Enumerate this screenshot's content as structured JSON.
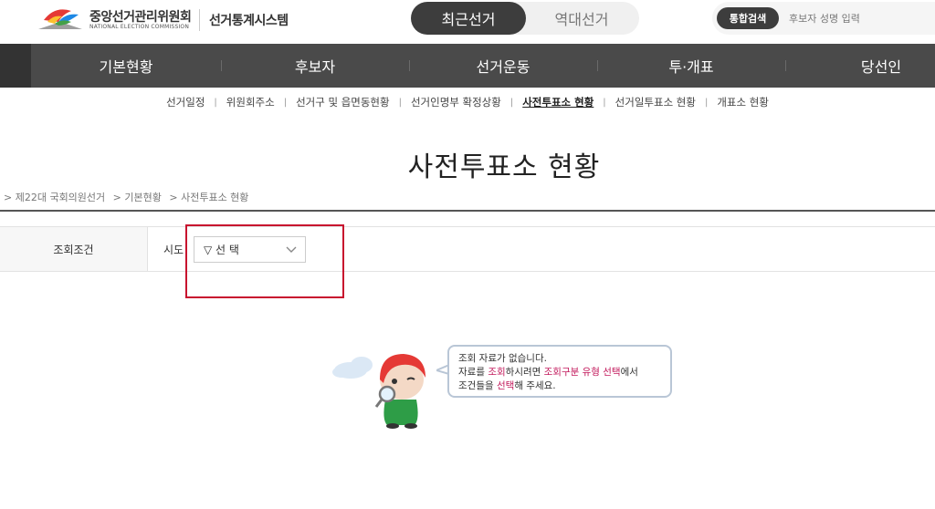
{
  "header": {
    "org_name": "중앙선거관리위원회",
    "org_name_en": "NATIONAL ELECTION COMMISSION",
    "system_name": "선거통계시스템",
    "toggle_recent": "최근선거",
    "toggle_past": "역대선거",
    "search_button": "통합검색",
    "search_placeholder": "후보자 성명 입력"
  },
  "main_nav": {
    "items": [
      "기본현황",
      "후보자",
      "선거운동",
      "투·개표",
      "당선인"
    ]
  },
  "sub_nav": {
    "items": [
      "선거일정",
      "위원회주소",
      "선거구 및 읍면동현황",
      "선거인명부 확정상황",
      "사전투표소 현황",
      "선거일투표소 현황",
      "개표소 현황"
    ],
    "active_index": 4
  },
  "page_title": "사전투표소 현황",
  "breadcrumb": [
    "> 제22대 국회의원선거",
    "> 기본현황",
    "> 사전투표소 현황"
  ],
  "filter": {
    "label": "조회조건",
    "sido_label": "시도",
    "select_value": "▽ 선 택"
  },
  "empty_state": {
    "line1": "조회 자료가 없습니다.",
    "line2_a": "자료를 ",
    "line2_b": "조회",
    "line2_c": "하시려면 ",
    "line2_d": "조회구분 유형 선택",
    "line2_e": "에서",
    "line3_a": "조건들을 ",
    "line3_b": "선택",
    "line3_c": "해 주세요."
  },
  "colors": {
    "nav_bg": "#4a4a4a",
    "highlight": "#c2185b",
    "annotation_red": "#c8102e"
  }
}
